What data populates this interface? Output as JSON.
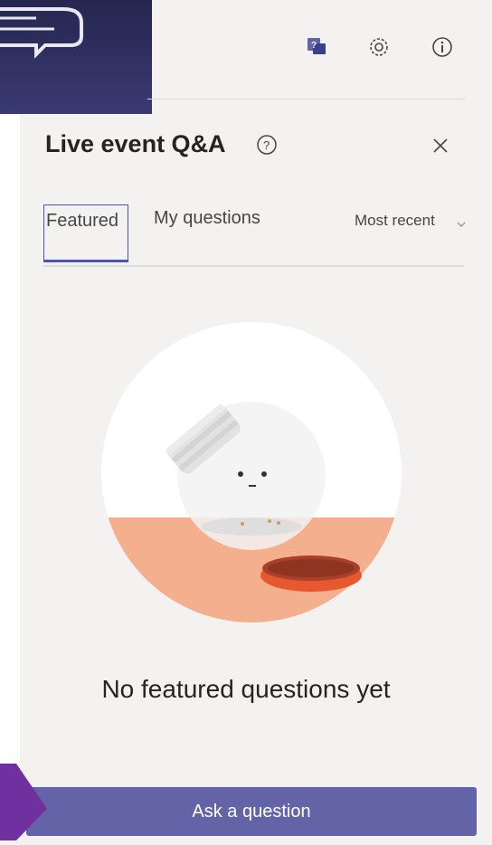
{
  "header": {
    "icons": [
      "qna-icon",
      "settings-icon",
      "info-icon"
    ]
  },
  "panel": {
    "title": "Live event Q&A",
    "tabs": [
      {
        "label": "Featured",
        "active": true
      },
      {
        "label": "My questions",
        "active": false
      }
    ],
    "sort_label": "Most recent",
    "empty_message": "No featured questions yet",
    "ask_button_label": "Ask a question"
  },
  "colors": {
    "accent": "#6264a7",
    "tab_active": "#4b53bc",
    "illustration_base": "#f4b08e",
    "lid": "#e6582e",
    "background": "#f3f2f1"
  }
}
